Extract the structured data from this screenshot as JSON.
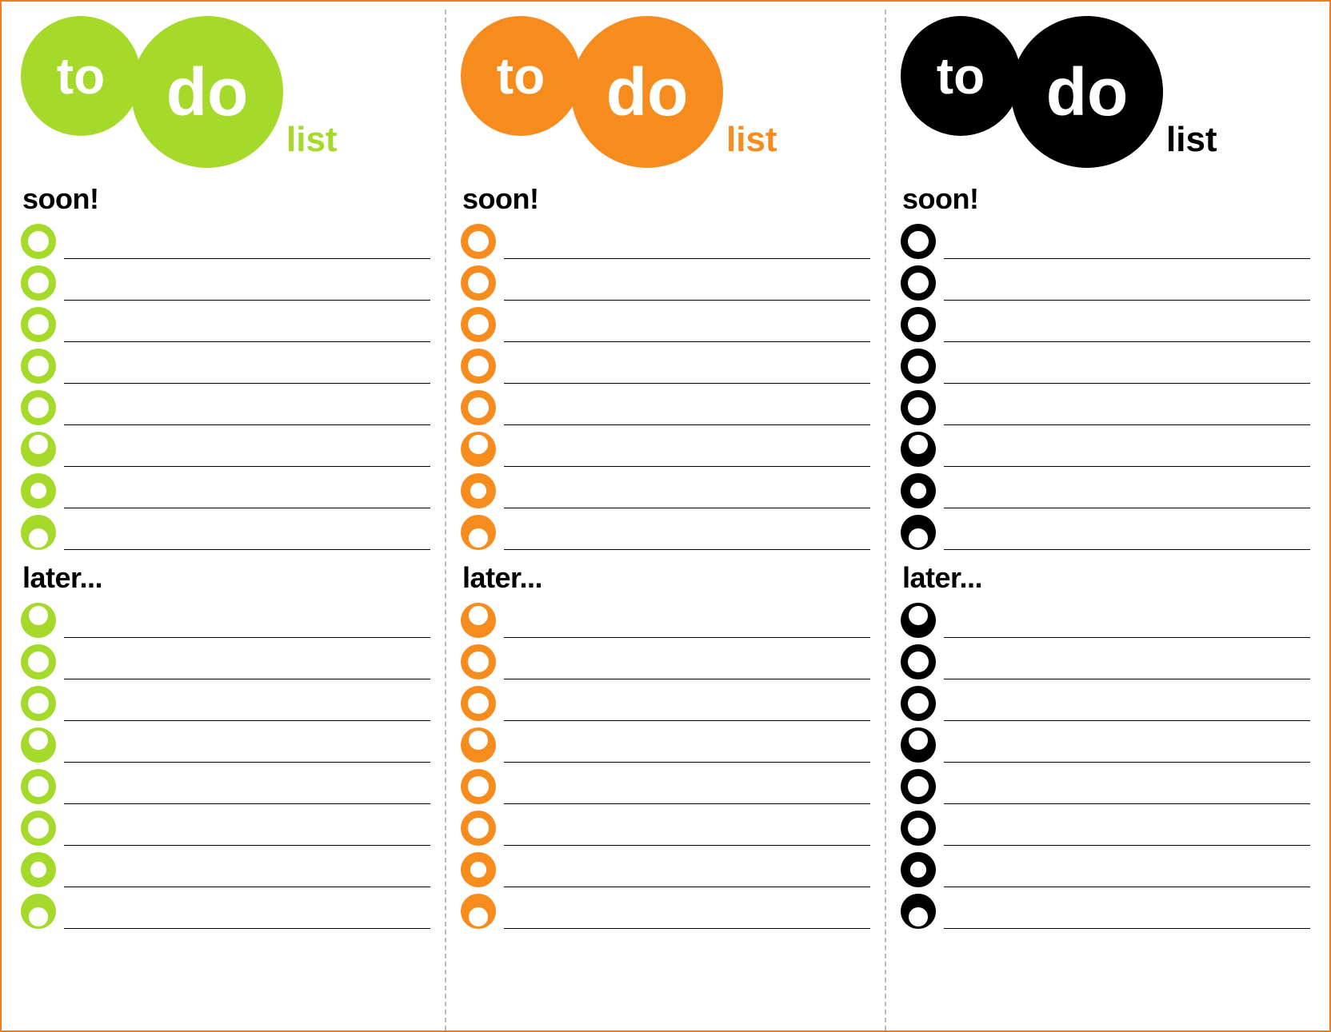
{
  "header": {
    "to": "to",
    "do": "do",
    "list": "list"
  },
  "sections": {
    "soon": "soon!",
    "later": "later..."
  },
  "columns": [
    {
      "name": "green",
      "color": "#a5d92a"
    },
    {
      "name": "orange",
      "color": "#f78c1e"
    },
    {
      "name": "black",
      "color": "#000000"
    }
  ],
  "bullets_soon": [
    {
      "style": "ring",
      "inner": [
        0.2,
        0.2,
        0.6,
        0.6
      ]
    },
    {
      "style": "ring",
      "inner": [
        0.2,
        0.2,
        0.6,
        0.6
      ]
    },
    {
      "style": "ring",
      "inner": [
        0.2,
        0.2,
        0.6,
        0.6
      ]
    },
    {
      "style": "ring",
      "inner": [
        0.2,
        0.2,
        0.6,
        0.6
      ]
    },
    {
      "style": "ring",
      "inner": [
        0.2,
        0.2,
        0.6,
        0.6
      ]
    },
    {
      "style": "offset-top",
      "inner": [
        0.22,
        0.08,
        0.56,
        0.56
      ]
    },
    {
      "style": "small",
      "inner": [
        0.28,
        0.28,
        0.44,
        0.44
      ]
    },
    {
      "style": "offset-bottom",
      "inner": [
        0.22,
        0.38,
        0.56,
        0.56
      ]
    }
  ],
  "bullets_later": [
    {
      "style": "offset-top",
      "inner": [
        0.22,
        0.08,
        0.56,
        0.56
      ]
    },
    {
      "style": "ring",
      "inner": [
        0.2,
        0.2,
        0.6,
        0.6
      ]
    },
    {
      "style": "ring",
      "inner": [
        0.2,
        0.2,
        0.6,
        0.6
      ]
    },
    {
      "style": "offset-top",
      "inner": [
        0.22,
        0.08,
        0.56,
        0.56
      ]
    },
    {
      "style": "ring",
      "inner": [
        0.2,
        0.2,
        0.6,
        0.6
      ]
    },
    {
      "style": "ring",
      "inner": [
        0.2,
        0.2,
        0.6,
        0.6
      ]
    },
    {
      "style": "small",
      "inner": [
        0.28,
        0.28,
        0.44,
        0.44
      ]
    },
    {
      "style": "offset-bottom",
      "inner": [
        0.22,
        0.38,
        0.56,
        0.56
      ]
    }
  ]
}
